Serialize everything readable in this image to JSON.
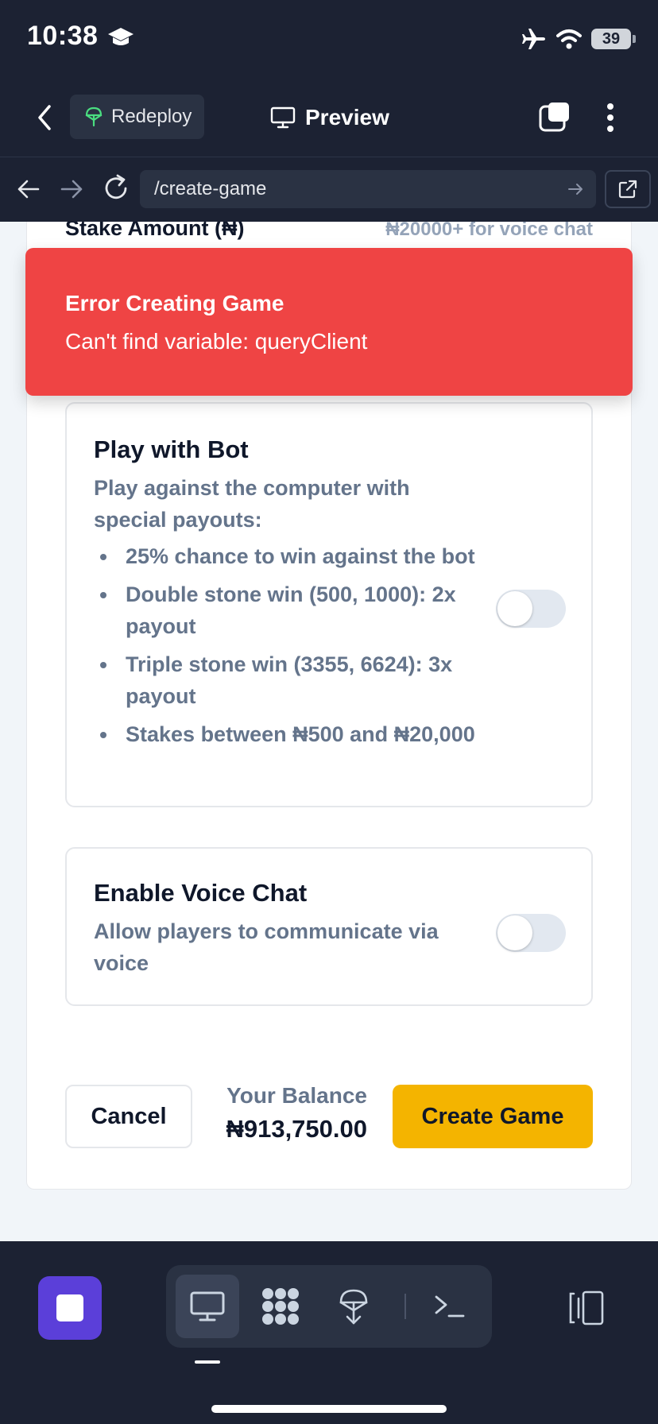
{
  "status_bar": {
    "time": "10:38",
    "battery": "39"
  },
  "toolbar": {
    "redeploy_label": "Redeploy",
    "preview_label": "Preview"
  },
  "url_bar": {
    "url": "/create-game"
  },
  "form": {
    "stake_label": "Stake Amount (₦)",
    "stake_hint": "₦20000+ for voice chat",
    "bot_option": {
      "title": "Play with Bot",
      "description": "Play against the computer with special payouts:",
      "bullets": [
        "25% chance to win against the bot",
        "Double stone win (500, 1000): 2x payout",
        "Triple stone win (3355, 6624): 3x payout",
        "Stakes between ₦500 and ₦20,000"
      ],
      "enabled": false
    },
    "voice_option": {
      "title": "Enable Voice Chat",
      "description": "Allow players to communicate via voice",
      "enabled": false
    },
    "cancel_label": "Cancel",
    "balance_label": "Your Balance",
    "balance_value": "₦913,750.00",
    "create_label": "Create Game"
  },
  "error_toast": {
    "title": "Error Creating Game",
    "message": "Can't find variable: queryClient"
  },
  "dock": {
    "items": [
      "preview-icon",
      "apps-grid-icon",
      "deploy-icon",
      "terminal-icon"
    ],
    "active_index": 0
  },
  "colors": {
    "chrome_bg": "#1c2233",
    "error": "#ef4444",
    "accent_yellow": "#f4b400",
    "stop_purple": "#5b3fd9"
  }
}
